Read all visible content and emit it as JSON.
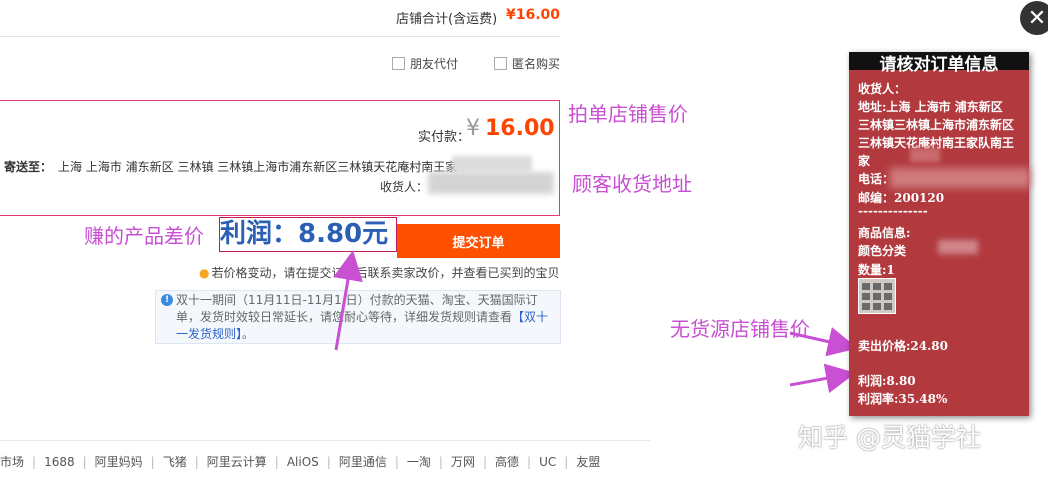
{
  "checkout": {
    "shop_total_label": "店铺合计(含运费)",
    "shop_total_value": "¥16.00",
    "options": {
      "friend_pay": "朋友代付",
      "anonymous": "匿名购买"
    },
    "paid_label": "实付款：",
    "paid_symbol": "¥",
    "paid_value": "16.00",
    "ship_to_label": "寄送至：",
    "ship_to_address": "上海 上海市 浦东新区 三林镇 三林镇上海市浦东新区三林镇天花庵村南王家",
    "receiver_label": "收货人：",
    "profit_text": "利润：8.80元",
    "submit_button": "提交订单",
    "notice_price": "若价格变动，请在提交订单后联系卖家改价，并查看已买到的宝贝",
    "notice_text": "双十一期间（11月11日-11月1 日）付款的天猫、淘宝、天猫国际订单，发货时效较日常延长，请您耐心等待，详细发货规则请查看",
    "notice_link": "【双十一发货规则】",
    "notice_tail": "。"
  },
  "footer": {
    "links": [
      "市场",
      "1688",
      "阿里妈妈",
      "飞猪",
      "阿里云计算",
      "AliOS",
      "阿里通信",
      "一淘",
      "万网",
      "高德",
      "UC",
      "友盟"
    ]
  },
  "annotations": {
    "shop_price": "拍单店铺售价",
    "address": "顾客收货地址",
    "profit": "赚的产品差价",
    "nosrc_price": "无货源店铺售价"
  },
  "panel": {
    "title": "请核对订单信息",
    "receiver": "收货人：",
    "address": "地址:上海 上海市 浦东新区 三林镇三林镇上海市浦东新区三林镇天花庵村南王家队南王家",
    "phone": "电话：",
    "zip": "邮编：200120",
    "dashes": "--------------",
    "goods": "商品信息:",
    "color": "颜色分类",
    "qty": "数量:1",
    "sell_price": "卖出价格:24.80",
    "profit": "利润:8.80",
    "profit_rate": "利润率:35.48%"
  },
  "close_icon": "close-icon",
  "watermark": "知乎 @灵猫学社",
  "colors": {
    "accent_orange": "#ff5000",
    "price_orange": "#ff4400",
    "annotation_magenta": "#c94fd3",
    "panel_red": "#b23a3f",
    "profit_blue": "#2b5fb4"
  }
}
